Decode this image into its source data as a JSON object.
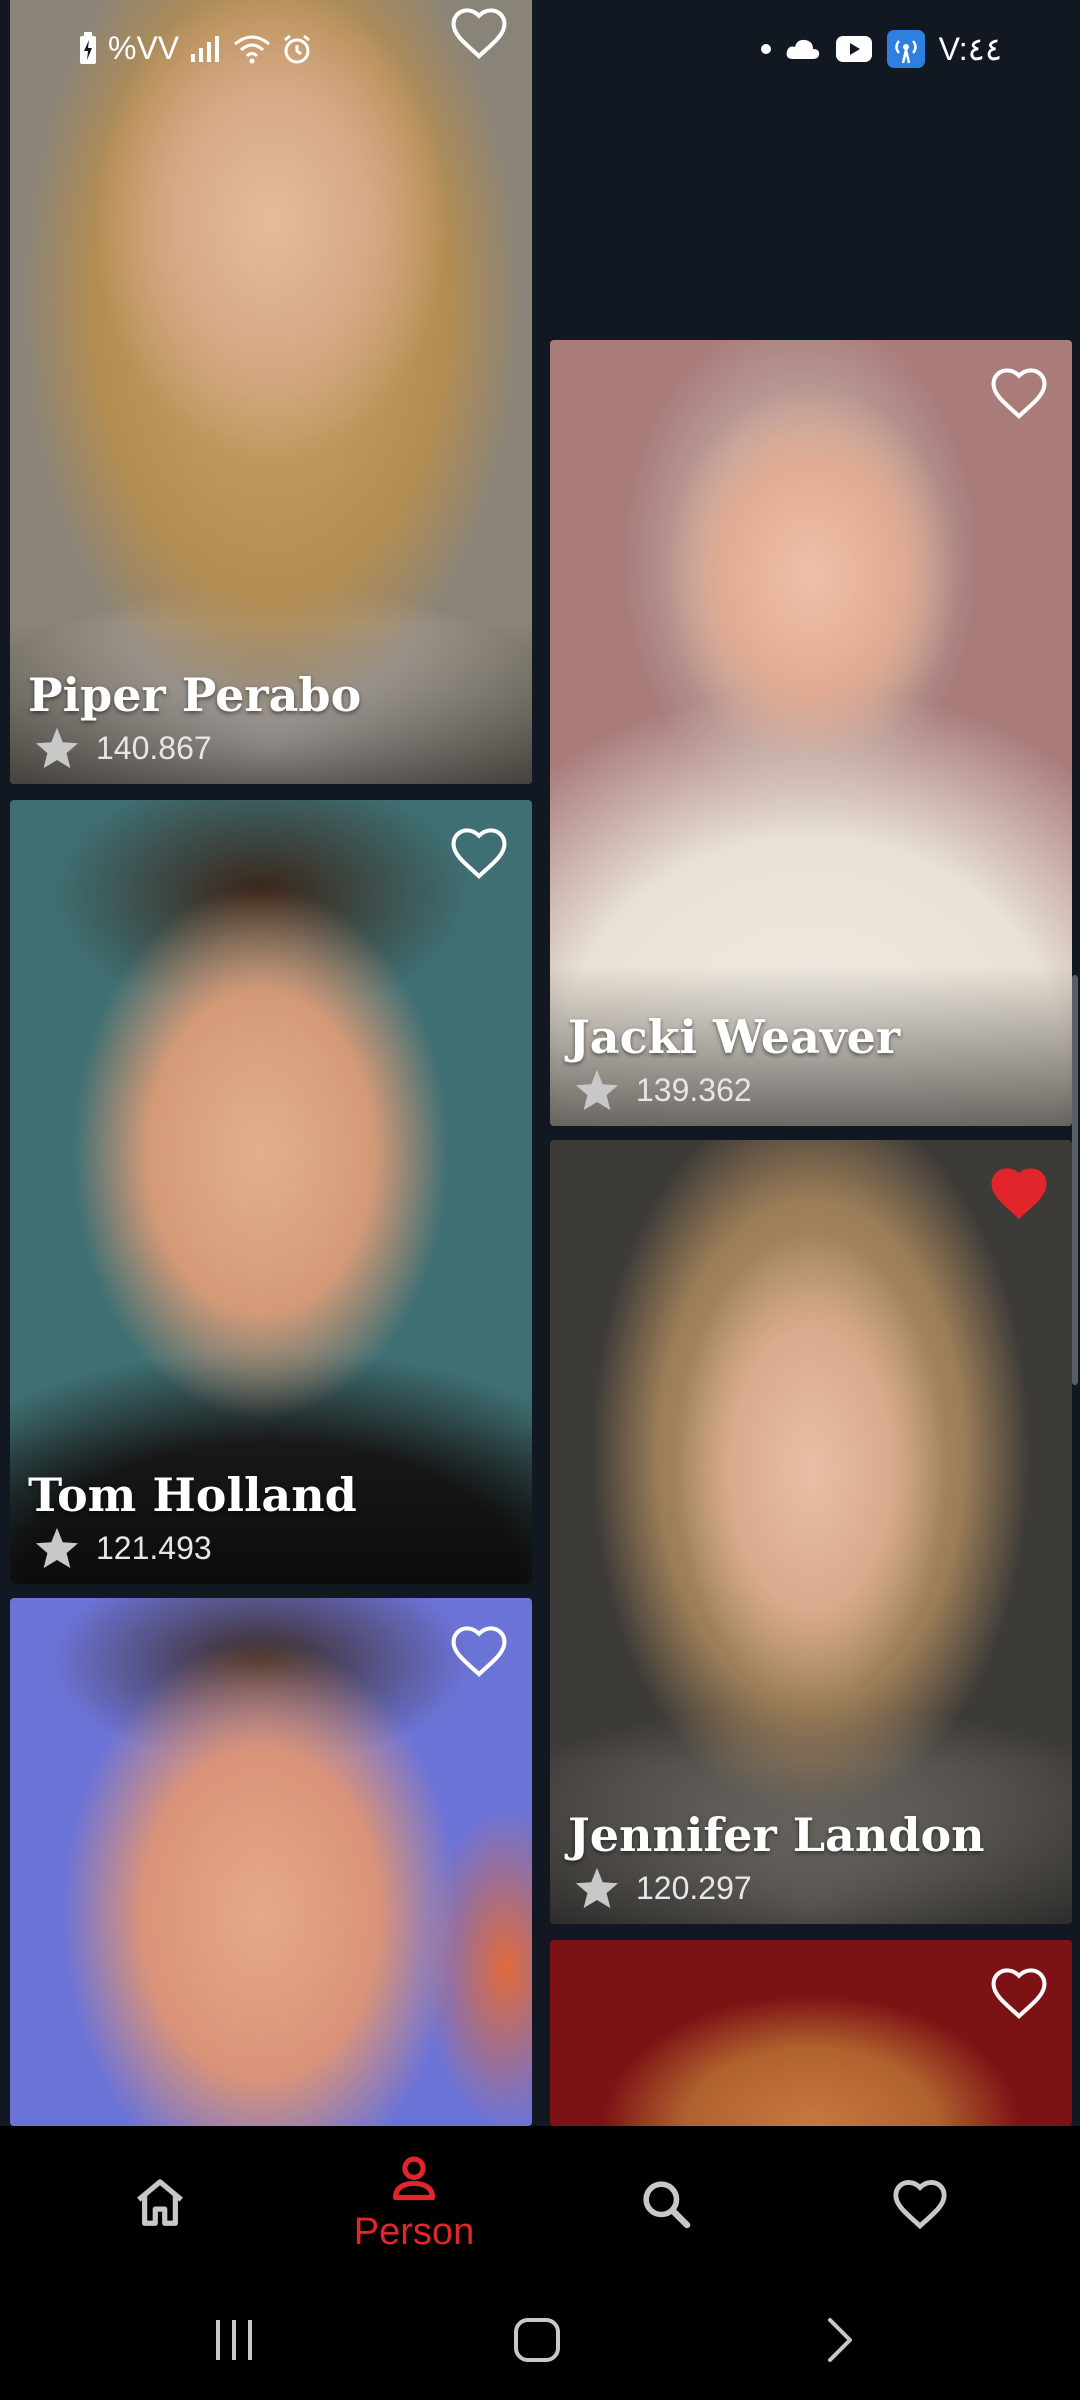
{
  "status_bar": {
    "battery_text": "%VV",
    "time": "V:٤٤"
  },
  "cards": [
    {
      "name": "Piper Perabo",
      "rating": "140.867",
      "favorite": false,
      "photo_colors": [
        "#8a8478",
        "#c9a56a"
      ]
    },
    {
      "name": "Jacki Weaver",
      "rating": "139.362",
      "favorite": false,
      "photo_colors": [
        "#a97c7a",
        "#e8e1d6"
      ]
    },
    {
      "name": "Tom Holland",
      "rating": "121.493",
      "favorite": false,
      "photo_colors": [
        "#3f6f73",
        "#1a1a1a"
      ]
    },
    {
      "name": "Jennifer Landon",
      "rating": "120.297",
      "favorite": true,
      "photo_colors": [
        "#3d3b38",
        "#bfa37e"
      ]
    },
    {
      "name": "",
      "rating": "",
      "favorite": false,
      "photo_colors": [
        "#6c73d6",
        "#d99a7f"
      ]
    },
    {
      "name": "",
      "rating": "",
      "favorite": false,
      "photo_colors": [
        "#7d1215",
        "#c7783f"
      ]
    }
  ],
  "bottom_nav": {
    "items": [
      {
        "id": "home",
        "label": ""
      },
      {
        "id": "person",
        "label": "Person"
      },
      {
        "id": "search",
        "label": ""
      },
      {
        "id": "favorites",
        "label": ""
      }
    ],
    "active": "person",
    "active_color": "#e0262b",
    "inactive_color": "#c8c8c8"
  },
  "colors": {
    "background": "#111821",
    "favorite_heart": "#e0262b"
  }
}
